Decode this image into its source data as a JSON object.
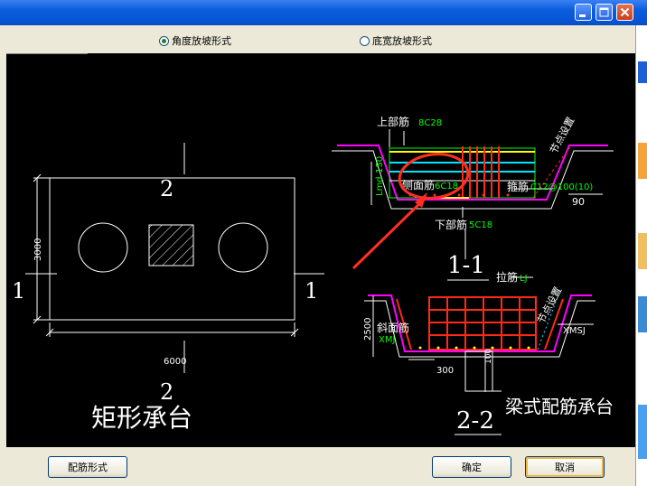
{
  "radio": {
    "angle_label": "角度放坡形式",
    "bottom_label": "底宽放坡形式",
    "selected": "angle"
  },
  "buttons": {
    "rebar_form": "配筋形式",
    "ok": "确定",
    "cancel": "取消"
  },
  "rect_cap": {
    "section_top": "2",
    "section_bottom": "2",
    "section_left": "1",
    "section_right": "1",
    "dim_height": "3000",
    "dim_width": "6000",
    "title": "矩形承台"
  },
  "section_11": {
    "top_bar": "上部筋",
    "top_bar_spec": "8C28",
    "side_bar": "侧面筋",
    "side_bar_spec": "6C18",
    "stirrup": "箍筋",
    "stirrup_spec": "C12@100(10)",
    "bottom_bar": "下部筋",
    "bottom_bar_spec": "5C18",
    "node_note": "节点设置",
    "height": "150",
    "height_prefix": "Lmd",
    "angle": "90",
    "title": "1-1"
  },
  "section_22": {
    "tie_bar": "拉筋",
    "tie_bar_spec": "LJ",
    "slope_bar": "斜面筋",
    "slope_bar_spec": "XMJ",
    "right_spec": "XMSJ",
    "node_note": "节点设置",
    "height": "2500",
    "width": "300",
    "small_dim": "100",
    "title": "2-2"
  },
  "beam_title": "梁式配筋承台",
  "colors": {
    "drawing_bg": "#000000",
    "rebar": "#ff2a1a",
    "top_bar": "#ffff00",
    "side_bars": "#00e5ff",
    "dim": "#00ff00",
    "outline": "#ff00ff",
    "annotation": "#ff3020"
  },
  "icons": [
    "minimize-icon",
    "maximize-icon",
    "close-icon"
  ]
}
